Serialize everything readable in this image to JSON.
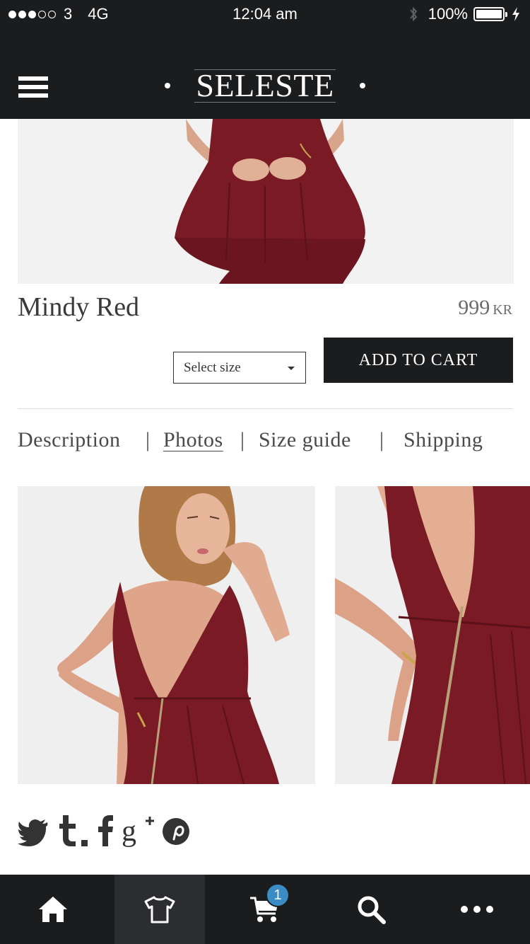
{
  "status_bar": {
    "carrier": "3",
    "network": "4G",
    "time": "12:04 am",
    "battery": "100%"
  },
  "header": {
    "logo": "SELESTE",
    "menu_icon": "hamburger-menu-icon"
  },
  "product": {
    "name": "Mindy Red",
    "price": "999",
    "currency": "KR",
    "size_select": "Select size",
    "add_to_cart": "ADD TO CART"
  },
  "tabs": {
    "items": [
      {
        "label": "Description"
      },
      {
        "label": "Photos",
        "active": true
      },
      {
        "label": "Size guide"
      },
      {
        "label": "Shipping"
      }
    ],
    "separator": "|"
  },
  "social": {
    "icons": [
      "twitter-icon",
      "tumblr-icon",
      "facebook-icon",
      "google-plus-icon",
      "pinterest-icon"
    ]
  },
  "bottom_nav": {
    "items": [
      {
        "icon": "home-icon"
      },
      {
        "icon": "tshirt-icon",
        "active": true
      },
      {
        "icon": "cart-icon"
      },
      {
        "icon": "search-icon"
      },
      {
        "icon": "more-icon"
      }
    ],
    "cart_count": "1"
  },
  "colors": {
    "dark_bar": "#1b1c1e",
    "dress": "#7a1a24",
    "badge": "#3b8bc4"
  }
}
